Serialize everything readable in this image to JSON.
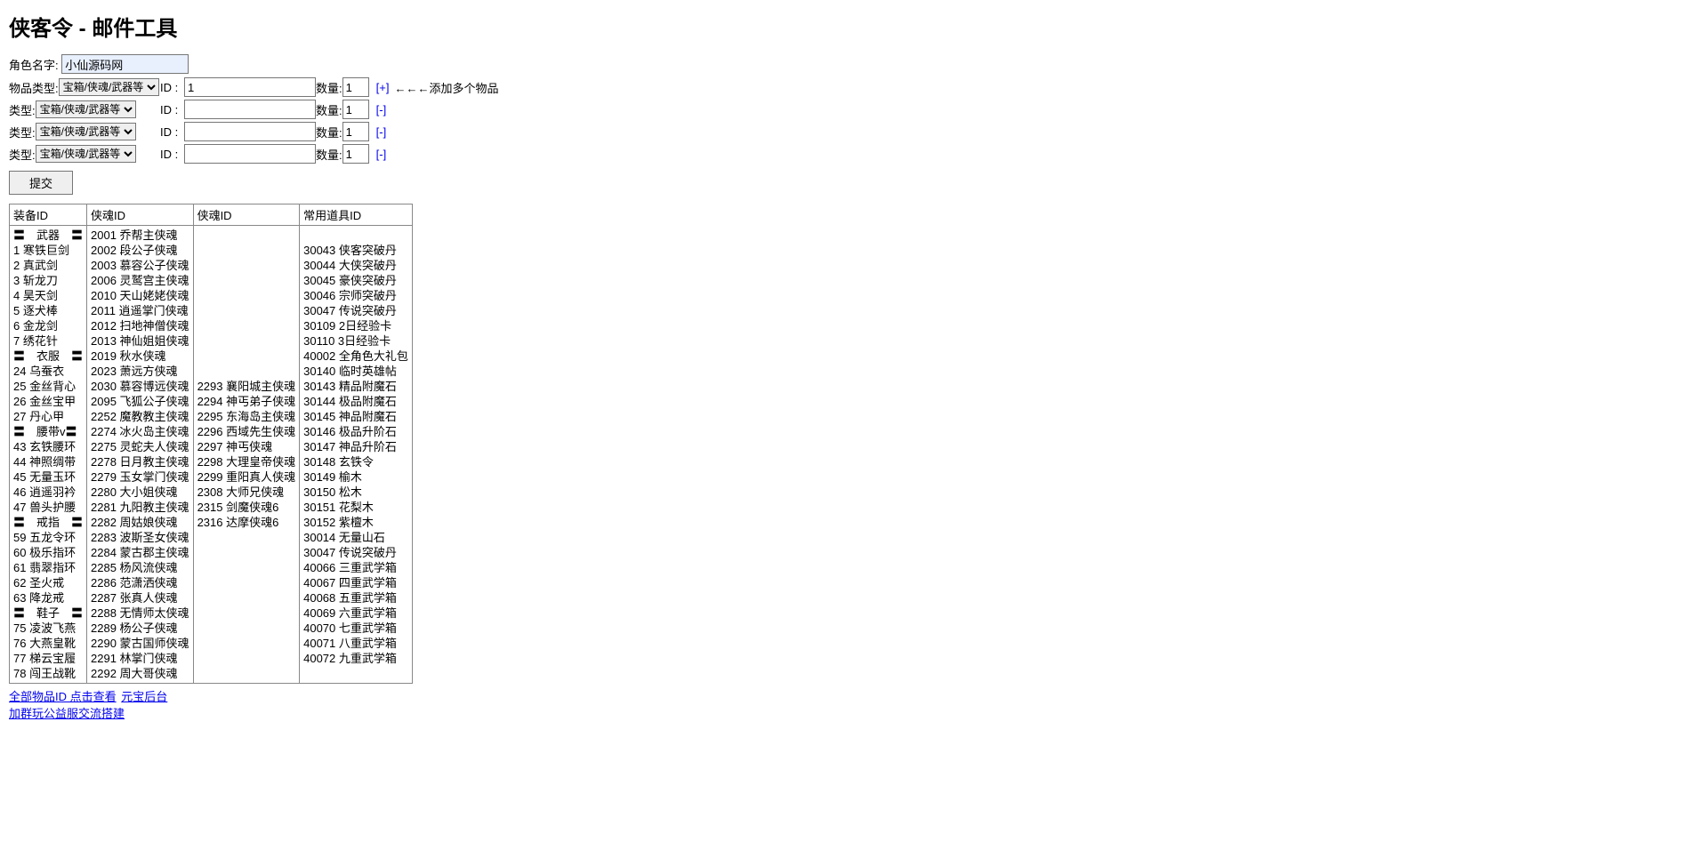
{
  "title": "侠客令 - 邮件工具",
  "labels": {
    "role_name": "角色名字:",
    "item_type_main": "物品类型:",
    "type": "类型:",
    "id": "ID :",
    "qty": "数量:",
    "add_link": "[+]",
    "remove_link": "[-]",
    "add_hint": "←←←添加多个物品",
    "submit": "提交"
  },
  "inputs": {
    "role_value": "小仙源码网",
    "id_main_value": "1",
    "qty_value": "1",
    "select_option": "宝箱/侠魂/武器等"
  },
  "extra_rows": 3,
  "table": {
    "headers": [
      "装备ID",
      "侠魂ID",
      "侠魂ID",
      "常用道具ID"
    ],
    "columns": [
      [
        "〓　武器　〓",
        "1 寒铁巨剑",
        "2 真武剑",
        "3 斩龙刀",
        "4 昊天剑",
        "5 逐犬棒",
        "6 金龙剑",
        "7 绣花针",
        "〓　衣服　〓",
        "24 乌蚕衣",
        "25 金丝背心",
        "26 金丝宝甲",
        "27 丹心甲",
        "〓　腰带v〓",
        "43 玄铁腰环",
        "44 神照绸带",
        "45 无量玉环",
        "46 逍遥羽衿",
        "47 兽头护腰",
        "〓　戒指　〓",
        "59 五龙令环",
        "60 极乐指环",
        "61 翡翠指环",
        "62 圣火戒",
        "63 降龙戒",
        "〓　鞋子　〓",
        "75 凌波飞燕",
        "76 大燕皇靴",
        "77 梯云宝履",
        "78 闯王战靴"
      ],
      [
        "2001 乔帮主侠魂",
        "2002 段公子侠魂",
        "2003 慕容公子侠魂",
        "2006 灵鹫宫主侠魂",
        "2010 天山姥姥侠魂",
        "2011 逍遥掌门侠魂",
        "2012 扫地神僧侠魂",
        "2013 神仙姐姐侠魂",
        "2019 秋水侠魂",
        "2023 萧远方侠魂",
        "2030 慕容博远侠魂",
        "2095 飞狐公子侠魂",
        "2252 魔教教主侠魂",
        "2274 冰火岛主侠魂",
        "2275 灵蛇夫人侠魂",
        "2278 日月教主侠魂",
        "2279 玉女掌门侠魂",
        "2280 大小姐侠魂",
        "2281 九阳教主侠魂",
        "2282 周姑娘侠魂",
        "2283 波斯圣女侠魂",
        "2284 蒙古郡主侠魂",
        "2285 杨风流侠魂",
        "2286 范潇洒侠魂",
        "2287 张真人侠魂",
        "2288 无情师太侠魂",
        "2289 杨公子侠魂",
        "2290 蒙古国师侠魂",
        "2291 林掌门侠魂",
        "2292 周大哥侠魂"
      ],
      [
        "",
        "",
        "",
        "",
        "",
        "",
        "",
        "",
        "",
        "",
        "2293 襄阳城主侠魂",
        "2294 神丐弟子侠魂",
        "2295 东海岛主侠魂",
        "2296 西域先生侠魂",
        "2297 神丐侠魂",
        "2298 大理皇帝侠魂",
        "2299 重阳真人侠魂",
        "2308 大师兄侠魂",
        "2315 剑魔侠魂6",
        "2316 达摩侠魂6",
        "",
        "",
        "",
        "",
        "",
        "",
        "",
        "",
        "",
        ""
      ],
      [
        "",
        "30043 侠客突破丹",
        "30044 大侠突破丹",
        "30045 豪侠突破丹",
        "30046 宗师突破丹",
        "30047 传说突破丹",
        "30109 2日经验卡",
        "30110 3日经验卡",
        "40002 全角色大礼包",
        "30140 临时英雄帖",
        "30143 精品附魔石",
        "30144 极品附魔石",
        "30145 神品附魔石",
        "30146 极品升阶石",
        "30147 神品升阶石",
        "30148 玄铁令",
        "30149 榆木",
        "30150 松木",
        "30151 花梨木",
        "30152 紫檀木",
        "30014 无量山石",
        "30047 传说突破丹",
        "40066 三重武学箱",
        "40067 四重武学箱",
        "40068 五重武学箱",
        "40069 六重武学箱",
        "40070 七重武学箱",
        "40071 八重武学箱",
        "40072 九重武学箱",
        ""
      ]
    ]
  },
  "bottom_links": {
    "all_items": "全部物品ID 点击查看",
    "yuanbao": "元宝后台",
    "group": "加群玩公益服交流搭建"
  }
}
